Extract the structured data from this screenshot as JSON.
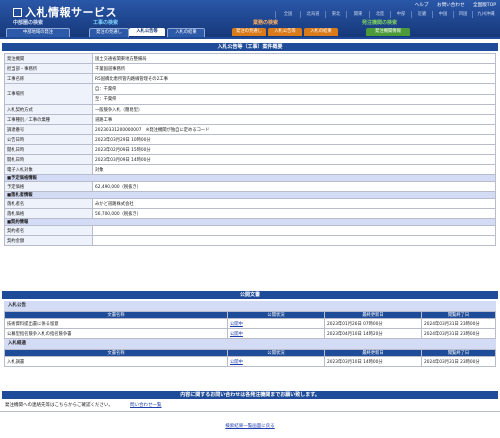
{
  "app": {
    "title": "入札情報サービス"
  },
  "util": [
    "ヘルプ",
    "お問い合わせ",
    "全国版TOP"
  ],
  "prefs": [
    "全国",
    "北海道",
    "東北",
    "関東",
    "北陸",
    "中部",
    "近畿",
    "中国",
    "四国",
    "九州沖縄"
  ],
  "groups": {
    "bid": "工事の検索",
    "bid_color": "#7fd0ff",
    "goods": "業務の検索",
    "goods_color": "#ffb060",
    "order": "発注機関の検索",
    "order_color": "#7fd060",
    "top": "中部圏の検索"
  },
  "tabs": {
    "t0": "中部地域の発注",
    "t1": "発注の見通し",
    "t2": "入札公告等",
    "t3": "入札の結果",
    "t4": "発注の見通し",
    "t5": "入札公告等",
    "t6": "入札の結果",
    "t7": "発注機関情報"
  },
  "page_title": "入札公告等（工事）案件概要",
  "detail": [
    {
      "label": "発注機関",
      "value": "国土交通省関東地方整備局"
    },
    {
      "label": "担当部・事務所",
      "value": "千葉国道事務所"
    },
    {
      "label": "工事名称",
      "value": "R5国橋比恵所管内路線管理その2工事"
    },
    {
      "label": "工事場所",
      "value": "自：千葉県",
      "value2": "至：千葉県"
    },
    {
      "label": "入札契約方式",
      "value": "一般競争入札（簡易型）"
    },
    {
      "label": "工事種別／工事の業種",
      "value": "道路工事"
    },
    {
      "label": "調達番号",
      "value": "20230331200000007　※発注機関が独自に定めるコード"
    },
    {
      "label": "公告日時",
      "value": "2023年03月29日 10時00分"
    },
    {
      "label": "開札日時",
      "value": "2023年02月09日 15時00分"
    },
    {
      "label": "開札日時",
      "value": "2023年03月09日 14時00分"
    },
    {
      "label": "電子入札対象",
      "value": "対象"
    }
  ],
  "sections": {
    "yotei": "■予定価格情報",
    "raku": "■落札者情報",
    "keiyaku": "■契約情報"
  },
  "price": {
    "label": "予定価格",
    "value": "62,490,000（税抜き）"
  },
  "winner": [
    {
      "label": "落札者名",
      "value": "みかど道路株式会社"
    },
    {
      "label": "落札価格",
      "value": "56,700,000（税抜き）"
    }
  ],
  "contract": [
    {
      "label": "契約者名",
      "value": ""
    },
    {
      "label": "契約金額",
      "value": ""
    }
  ],
  "public": {
    "title": "公開文書",
    "notice": "入札公告",
    "cols": [
      "文書名称",
      "公開状況",
      "最終更新日",
      "閲覧終了日"
    ],
    "rows": [
      {
        "name": "技術資料提出書に係る留意",
        "status": "公開中",
        "updated": "2023年01月26日 07時00分",
        "end": "2024年03月31日 23時00分"
      },
      {
        "name": "公募型指名競争入札の指名競争書",
        "status": "公開中",
        "updated": "2023年04月10日 14時20分",
        "end": "2024年03月31日 23時00分"
      }
    ],
    "result": "入札経過",
    "rows2": [
      {
        "name": "入札調書",
        "status": "公開中",
        "updated": "2023年03月10日 14時00分",
        "end": "2024年03月31日 23時00分"
      }
    ]
  },
  "contact": {
    "banner": "内容に関するお問い合わせは各発注機関までお願い致します。",
    "label": "発注機関への連絡先等はこちらからご確認ください。",
    "link": "問い合わせ一覧"
  },
  "back": "検索結果一覧画面に戻る"
}
